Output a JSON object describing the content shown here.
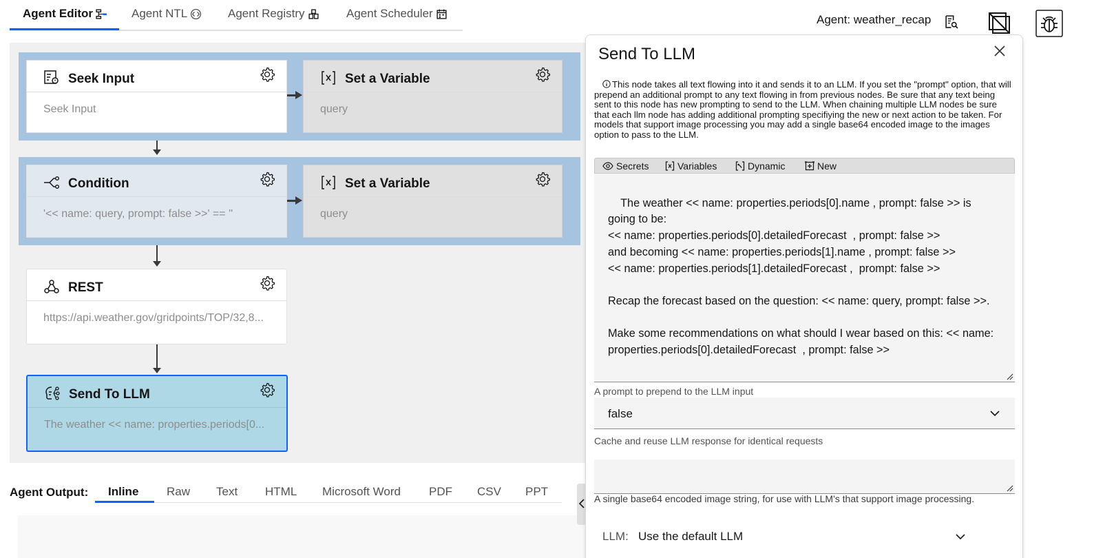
{
  "top_tabs": [
    {
      "label": "Agent Editor",
      "icon": "flow-icon"
    },
    {
      "label": "Agent NTL",
      "icon": "code-icon"
    },
    {
      "label": "Agent Registry",
      "icon": "registry-icon"
    },
    {
      "label": "Agent Scheduler",
      "icon": "calendar-icon"
    }
  ],
  "header": {
    "agent_label": "Agent: weather_recap",
    "icons": [
      "search-document-icon",
      "hide-panel-icon",
      "debug-icon"
    ]
  },
  "nodes": {
    "seek_input": {
      "title": "Seek Input",
      "body": "Seek Input"
    },
    "set_var_1": {
      "title": "Set a Variable",
      "body": "query"
    },
    "condition": {
      "title": "Condition",
      "body": "'<< name: query, prompt: false >>' == ''"
    },
    "set_var_2": {
      "title": "Set a Variable",
      "body": "query"
    },
    "rest": {
      "title": "REST",
      "body": "https://api.weather.gov/gridpoints/TOP/32,8..."
    },
    "send_llm": {
      "title": "Send To LLM",
      "body": "The weather << name: properties.periods[0..."
    }
  },
  "output": {
    "label": "Agent Output:",
    "tabs": [
      "Inline",
      "Raw",
      "Text",
      "HTML",
      "Microsoft Word",
      "PDF",
      "CSV",
      "PPT"
    ]
  },
  "panel": {
    "title": "Send To LLM",
    "description": "This node takes all text flowing into it and sends it to an LLM. If you set the \"prompt\" option, that will prepend an additional prompt to any text flowing in from previous nodes. Be sure that any text being sent to this node has new prompting to send to the LLM. When chaining multiple LLM nodes be sure that each llm node has adding additional prompting specifiying the new or next action to be taken. For models that support image processing you may add a single base64 encoded image to the images option to pass to the LLM.",
    "toolbar": [
      "Secrets",
      "Variables",
      "Dynamic",
      "New"
    ],
    "prompt_text": "The weather << name: properties.periods[0].name , prompt: false >> is going to be:\n<< name: properties.periods[0].detailedForecast  , prompt: false >>\nand becoming << name: properties.periods[1].name , prompt: false >>\n<< name: properties.periods[1].detailedForecast ,  prompt: false >>\n\nRecap the forecast based on the question: << name: query, prompt: false >>.\n\nMake some recommendations on what should I wear based on this: << name: properties.periods[0].detailedForecast  , prompt: false >>",
    "prepend_label": "A prompt to prepend to the LLM input",
    "prepend_value": "false",
    "cache_label": "Cache and reuse LLM response for identical requests",
    "image_label": "A single base64 encoded image string, for use with LLM's that support image processing.",
    "llm_label": "LLM:",
    "llm_value": "Use the default LLM"
  },
  "colors": {
    "accent": "#0f62fe",
    "group_bg": "#a6c4e0",
    "selected_node": "#aed8e6",
    "canvas_bg": "#f0f0f0"
  }
}
